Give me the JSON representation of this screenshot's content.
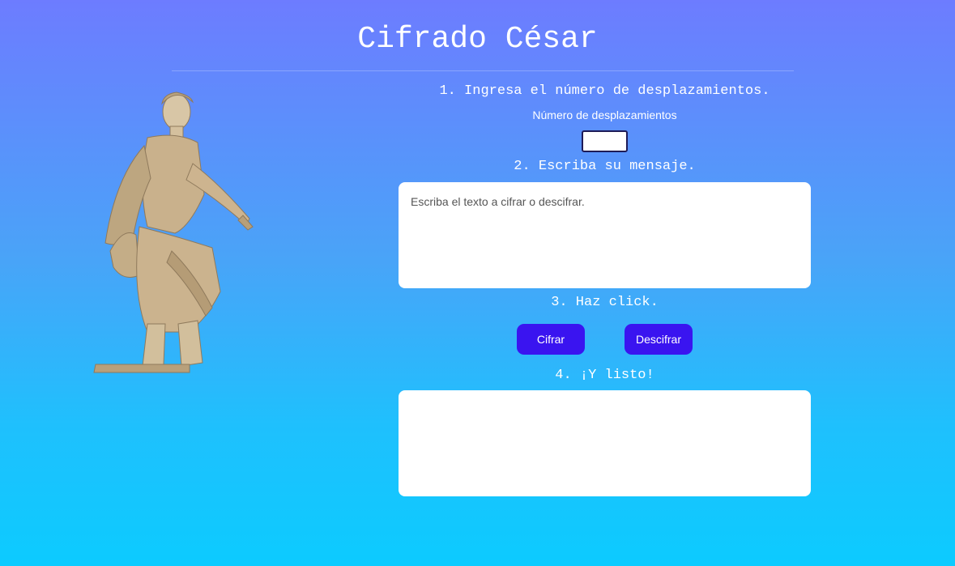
{
  "header": {
    "title": "Cifrado César"
  },
  "steps": {
    "step1": "1. Ingresa el número de desplazamientos.",
    "step2": "2. Escriba su mensaje.",
    "step3": "3. Haz click.",
    "step4": "4. ¡Y listo!"
  },
  "shift": {
    "label": "Número de desplazamientos",
    "value": ""
  },
  "message": {
    "placeholder": "Escriba el texto a cifrar o descifrar.",
    "value": ""
  },
  "buttons": {
    "encrypt": "Cifrar",
    "decrypt": "Descifrar"
  },
  "result": {
    "value": ""
  },
  "images": {
    "statue": "julius-caesar-statue"
  },
  "colors": {
    "button": "#3a14f0",
    "background_top": "#6d7cff",
    "background_bottom": "#0ccbff"
  }
}
